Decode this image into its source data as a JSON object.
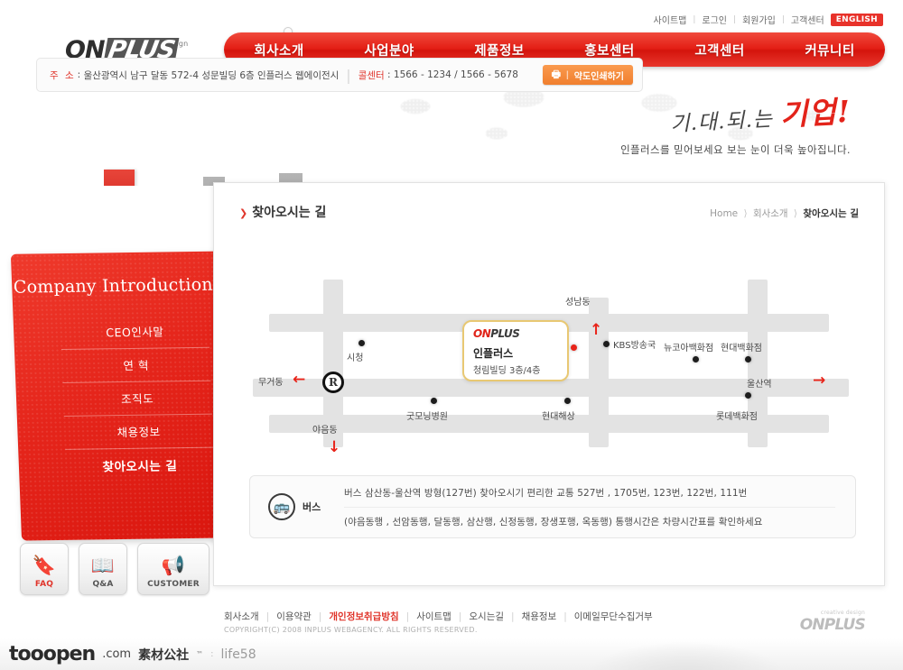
{
  "topbar": {
    "links": [
      "사이트맵",
      "로그인",
      "회원가입",
      "고객센터"
    ],
    "english": "ENGLISH"
  },
  "logo": {
    "name": "ONPLUS",
    "on": "ON",
    "plus": "PLUS",
    "tagline": "creative design"
  },
  "mainnav": {
    "items": [
      "회사소개",
      "사업분야",
      "제품정보",
      "홍보센터",
      "고객센터",
      "커뮤니티"
    ],
    "active": "회사소개"
  },
  "subnav": {
    "items": [
      "CEO인사말",
      "연 혁",
      "조직도",
      "채용정보",
      "찾아오시는길"
    ]
  },
  "hero": {
    "headline_small": "기.대.되.는",
    "headline_big": "기업!",
    "subtext": "인플러스를 믿어보세요 보는 눈이 더욱 높아집니다."
  },
  "sidebar": {
    "title": "Company Introduction",
    "items": [
      "CEO인사말",
      "연    혁",
      "조직도",
      "채용정보",
      "찾아오시는 길"
    ],
    "active_index": 4
  },
  "quicks": [
    {
      "label": "FAQ",
      "icon": "question-icon",
      "glyph": "🔖"
    },
    {
      "label": "Q&A",
      "icon": "book-icon",
      "glyph": "📖"
    },
    {
      "label": "CUSTOMER",
      "icon": "megaphone-icon",
      "glyph": "📢"
    }
  ],
  "page": {
    "title": "찾아오시는 길",
    "breadcrumb": {
      "home": "Home",
      "section": "회사소개",
      "current": "찾아오시는 길"
    }
  },
  "address": {
    "label": "주 소",
    "value": "울산광역시 남구 달동 572-4 성문빌딩 6층 인플러스 웹에이전시",
    "call_label": "콜센터",
    "call_value": "1566 - 1234 / 1566 - 5678",
    "print_button": "약도인쇄하기",
    "print_icon": "printer-icon"
  },
  "map": {
    "callout": {
      "logo_on": "ON",
      "logo_plus": "PLUS",
      "logo_tag": "creative design",
      "name": "인플러스",
      "desc": "청림빌딩 3층/4층"
    },
    "marker_r": "R",
    "labels": [
      {
        "name": "무거동",
        "dir": "left"
      },
      {
        "name": "성남동",
        "dir": "up"
      },
      {
        "name": "야음동",
        "dir": "down"
      },
      {
        "name": "울산역",
        "dir": "right"
      },
      {
        "name": "시청"
      },
      {
        "name": "KBS방송국"
      },
      {
        "name": "뉴코아백화점"
      },
      {
        "name": "현대백화점"
      },
      {
        "name": "굿모닝병원"
      },
      {
        "name": "현대해상"
      },
      {
        "name": "롯데백화점"
      }
    ]
  },
  "bus": {
    "label": "버스",
    "icon": "bus-icon",
    "line1": "버스 삼산동-울산역 방형(127번) 찾아오시기 편리한 교통 527번 , 1705번, 123번, 122번, 111번",
    "line2": "(야음동행 , 선암동행, 달동행, 삼산행, 신정동행, 장생포행, 옥동행) 통행시간은  차량시간표를 확인하세요"
  },
  "footer": {
    "links": [
      "회사소개",
      "이용약관",
      "개인정보취급방침",
      "사이트맵",
      "오시는길",
      "채용정보",
      "이메일무단수집거부"
    ],
    "highlight_index": 2,
    "copyright": "COPYRIGHT(C) 2008 INPLUS WEBAGENCY. ALL RIGHTS RESERVED.",
    "logo_on": "ON",
    "logo_plus": "PLUS",
    "logo_tag": "creative design"
  },
  "watermark": {
    "main": "tooopen",
    "com": ".com",
    "cn": "素材公社",
    "tm": "™",
    "life": "life58"
  }
}
